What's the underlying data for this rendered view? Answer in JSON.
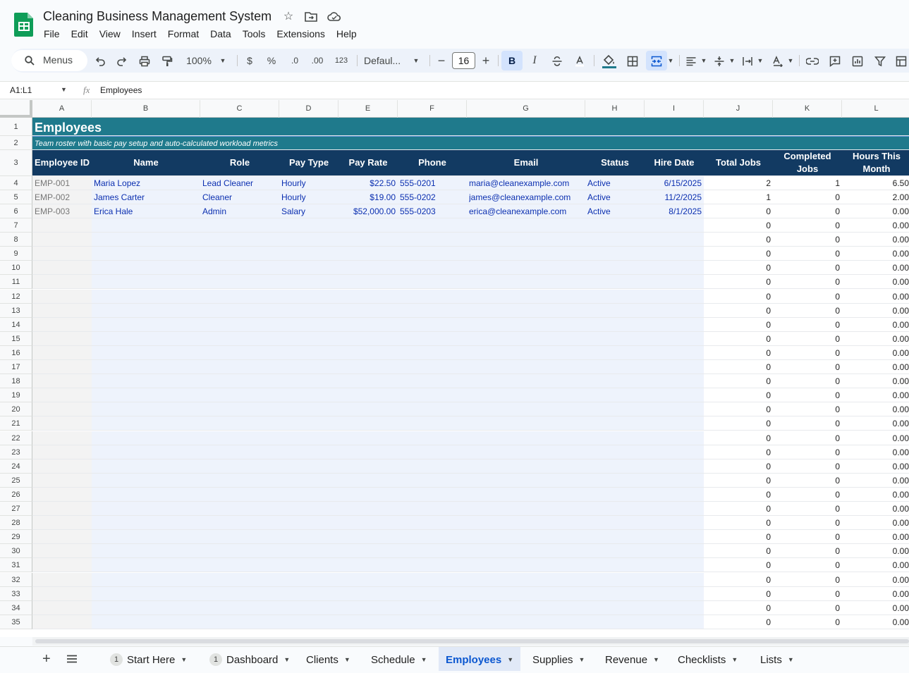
{
  "app": {
    "title": "Cleaning Business Management System",
    "menu": [
      "File",
      "Edit",
      "View",
      "Insert",
      "Format",
      "Data",
      "Tools",
      "Extensions",
      "Help"
    ]
  },
  "toolbar": {
    "search_label": "Menus",
    "zoom": "100%",
    "currency": "$",
    "percent": "%",
    "decrease_decimal": ".0",
    "increase_decimal": ".00",
    "number_format": "123",
    "font": "Defaul...",
    "font_size": "16",
    "minus": "−",
    "plus": "+",
    "bold": "B",
    "italic": "I"
  },
  "formula_bar": {
    "range": "A1:L1",
    "fx": "fx",
    "value": "Employees"
  },
  "columns": [
    "A",
    "B",
    "C",
    "D",
    "E",
    "F",
    "G",
    "H",
    "I",
    "J",
    "K",
    "L"
  ],
  "sheet": {
    "title": "Employees",
    "subtitle": "Team roster with basic pay setup and auto-calculated workload metrics",
    "headers": [
      "Employee ID",
      "Name",
      "Role",
      "Pay Type",
      "Pay Rate",
      "Phone",
      "Email",
      "Status",
      "Hire Date",
      "Total Jobs",
      "Completed Jobs",
      "Hours This Month"
    ],
    "rows": [
      [
        "EMP-001",
        "Maria Lopez",
        "Lead Cleaner",
        "Hourly",
        "$22.50",
        "555-0201",
        "maria@cleanexample.com",
        "Active",
        "6/15/2025",
        "2",
        "1",
        "6.50"
      ],
      [
        "EMP-002",
        "James Carter",
        "Cleaner",
        "Hourly",
        "$19.00",
        "555-0202",
        "james@cleanexample.com",
        "Active",
        "11/2/2025",
        "1",
        "0",
        "2.00"
      ],
      [
        "EMP-003",
        "Erica Hale",
        "Admin",
        "Salary",
        "$52,000.00",
        "555-0203",
        "erica@cleanexample.com",
        "Active",
        "8/1/2025",
        "0",
        "0",
        "0.00"
      ]
    ],
    "empty_row_values": [
      "0",
      "0",
      "0.00"
    ],
    "row_numbers": [
      "1",
      "2",
      "3",
      "4",
      "5",
      "6",
      "7",
      "8",
      "9",
      "10",
      "11",
      "12",
      "13",
      "14",
      "15",
      "16",
      "17",
      "18",
      "19",
      "20",
      "21",
      "22",
      "23",
      "24",
      "25",
      "26",
      "27",
      "28",
      "29",
      "30",
      "31",
      "32",
      "33",
      "34",
      "35"
    ]
  },
  "tabs": [
    {
      "label": "Start Here",
      "badge": "1"
    },
    {
      "label": "Dashboard",
      "badge": "1"
    },
    {
      "label": "Clients"
    },
    {
      "label": "Schedule"
    },
    {
      "label": "Employees",
      "active": true
    },
    {
      "label": "Supplies"
    },
    {
      "label": "Revenue"
    },
    {
      "label": "Checklists"
    },
    {
      "label": "Lists"
    }
  ],
  "colors": {
    "title_bg": "#1f7a8c",
    "header_bg": "#123a62",
    "input_area": "#eef3fc",
    "active_tab": "#0b57d0"
  }
}
